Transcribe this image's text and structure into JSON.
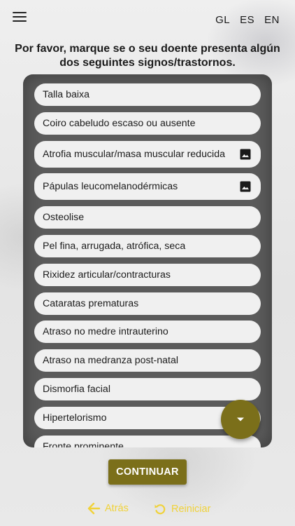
{
  "header": {
    "languages": [
      "GL",
      "ES",
      "EN"
    ]
  },
  "prompt": "Por favor, marque se o seu doente presenta algún dos seguintes signos/trastornos.",
  "items": [
    {
      "label": "Talla baixa",
      "has_image": false
    },
    {
      "label": "Coiro cabeludo escaso ou ausente",
      "has_image": false
    },
    {
      "label": "Atrofia muscular/masa muscular reducida",
      "has_image": true
    },
    {
      "label": "Pápulas leucomelanodérmicas",
      "has_image": true
    },
    {
      "label": "Osteolise",
      "has_image": false
    },
    {
      "label": "Pel fina, arrugada, atrófica, seca",
      "has_image": false
    },
    {
      "label": "Rixidez articular/contracturas",
      "has_image": false
    },
    {
      "label": "Cataratas prematuras",
      "has_image": false
    },
    {
      "label": "Atraso no medre intrauterino",
      "has_image": false
    },
    {
      "label": "Atraso na medranza post-natal",
      "has_image": false
    },
    {
      "label": "Dismorfia facial",
      "has_image": false
    },
    {
      "label": "Hipertelorismo",
      "has_image": false
    },
    {
      "label": "Fronte prominente",
      "has_image": false
    }
  ],
  "icons": {
    "menu": "menu-icon",
    "item_image": "image-icon",
    "scroll_down": "chevron-down-icon",
    "back": "arrow-left-icon",
    "reset": "restart-icon"
  },
  "colors": {
    "accent": "#7b6f1a",
    "nav_text": "#f0d23a",
    "panel": "#5b5b5b",
    "item_bg": "#f0f0f0"
  },
  "actions": {
    "continue_label": "CONTINUAR",
    "back_label": "Atrás",
    "reset_label": "Reiniciar"
  }
}
